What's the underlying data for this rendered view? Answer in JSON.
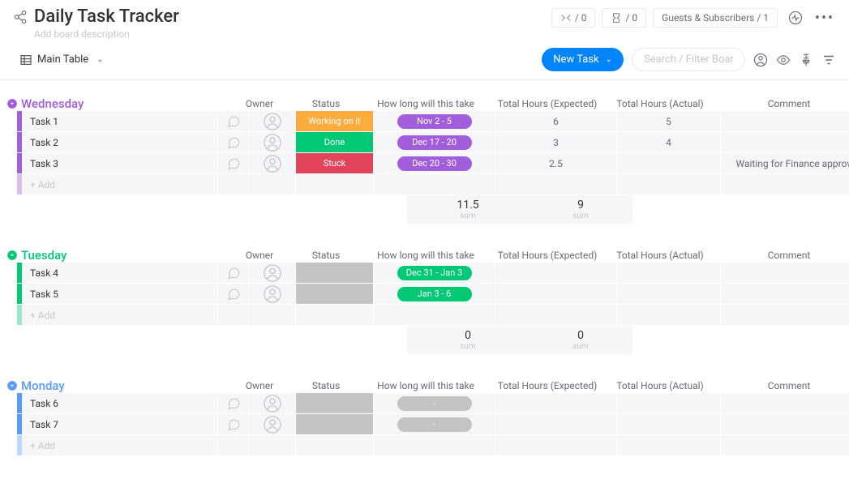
{
  "header": {
    "title": "Daily Task Tracker",
    "description": "Add board description",
    "conversations": "/ 0",
    "activity": "/ 0",
    "guests": "Guests & Subscribers / 1"
  },
  "toolbar": {
    "view": "Main Table",
    "newTask": "New Task",
    "searchPlaceholder": "Search / Filter Board"
  },
  "columns": {
    "owner": "Owner",
    "status": "Status",
    "timeline": "How long will this take",
    "expected": "Total Hours (Expected)",
    "actual": "Total Hours (Actual)",
    "comment": "Comment"
  },
  "groups": [
    {
      "name": "Wednesday",
      "color": "#a25ddc",
      "rows": [
        {
          "name": "Task 1",
          "status": "Working on it",
          "statusColor": "#fdab3d",
          "timeline": "Nov 2 - 5",
          "timelineColor": "#a25ddc",
          "expected": "6",
          "actual": "5",
          "comment": ""
        },
        {
          "name": "Task 2",
          "status": "Done",
          "statusColor": "#00c875",
          "timeline": "Dec 17 - 20",
          "timelineColor": "#a25ddc",
          "expected": "3",
          "actual": "4",
          "comment": ""
        },
        {
          "name": "Task 3",
          "status": "Stuck",
          "statusColor": "#e2445c",
          "timeline": "Dec 20 - 30",
          "timelineColor": "#a25ddc",
          "expected": "2.5",
          "actual": "",
          "comment": "Waiting for Finance approval"
        }
      ],
      "addLabel": "+ Add",
      "sumExpected": "11.5",
      "sumActual": "9",
      "sumLabel": "sum"
    },
    {
      "name": "Tuesday",
      "color": "#00c875",
      "rows": [
        {
          "name": "Task 4",
          "status": "",
          "statusColor": "#c4c4c4",
          "timeline": "Dec 31 - Jan 3",
          "timelineColor": "#00c875",
          "expected": "",
          "actual": "",
          "comment": ""
        },
        {
          "name": "Task 5",
          "status": "",
          "statusColor": "#c4c4c4",
          "timeline": "Jan 3 - 6",
          "timelineColor": "#00c875",
          "expected": "",
          "actual": "",
          "comment": ""
        }
      ],
      "addLabel": "+ Add",
      "sumExpected": "0",
      "sumActual": "0",
      "sumLabel": "sum"
    },
    {
      "name": "Monday",
      "color": "#579bfc",
      "rows": [
        {
          "name": "Task 6",
          "status": "",
          "statusColor": "#c4c4c4",
          "timeline": "-",
          "timelineColor": "#c4c4c4",
          "expected": "",
          "actual": "",
          "comment": ""
        },
        {
          "name": "Task 7",
          "status": "",
          "statusColor": "#c4c4c4",
          "timeline": "-",
          "timelineColor": "#c4c4c4",
          "expected": "",
          "actual": "",
          "comment": ""
        }
      ],
      "addLabel": "+ Add",
      "sumExpected": "0",
      "sumActual": "0",
      "sumLabel": "sum"
    }
  ]
}
